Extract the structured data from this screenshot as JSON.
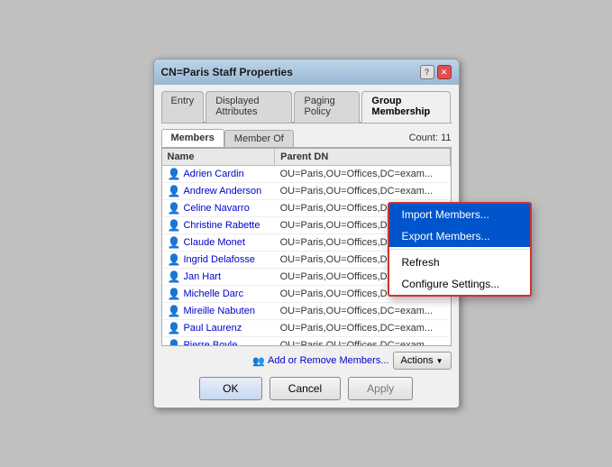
{
  "window": {
    "title": "CN=Paris Staff Properties",
    "help_label": "?",
    "close_label": "✕"
  },
  "tabs": [
    {
      "id": "entry",
      "label": "Entry"
    },
    {
      "id": "displayed-attributes",
      "label": "Displayed Attributes"
    },
    {
      "id": "paging-policy",
      "label": "Paging Policy"
    },
    {
      "id": "group-membership",
      "label": "Group Membership",
      "active": true
    }
  ],
  "inner_tabs": [
    {
      "id": "members",
      "label": "Members",
      "active": true
    },
    {
      "id": "member-of",
      "label": "Member Of"
    }
  ],
  "count_label": "Count: 11",
  "columns": [
    {
      "id": "name",
      "label": "Name"
    },
    {
      "id": "parent-dn",
      "label": "Parent DN"
    }
  ],
  "members": [
    {
      "name": "Adrien Cardin",
      "dn": "OU=Paris,OU=Offices,DC=exam..."
    },
    {
      "name": "Andrew Anderson",
      "dn": "OU=Paris,OU=Offices,DC=exam..."
    },
    {
      "name": "Celine Navarro",
      "dn": "OU=Paris,OU=Offices,DC=exam..."
    },
    {
      "name": "Christine Rabette",
      "dn": "OU=Paris,OU=Offices,DC=exam..."
    },
    {
      "name": "Claude Monet",
      "dn": "OU=Paris,OU=Offices,DC=exam..."
    },
    {
      "name": "Ingrid Delafosse",
      "dn": "OU=Paris,OU=Offices,DC=exam..."
    },
    {
      "name": "Jan Hart",
      "dn": "OU=Paris,OU=Offices,DC=exam..."
    },
    {
      "name": "Michelle Darc",
      "dn": "OU=Paris,OU=Offices,DC=exam..."
    },
    {
      "name": "Mireille Nabuten",
      "dn": "OU=Paris,OU=Offices,DC=exam..."
    },
    {
      "name": "Paul Laurenz",
      "dn": "OU=Paris,OU=Offices,DC=exam..."
    },
    {
      "name": "Pierre Boyle",
      "dn": "OU=Paris,OU=Offices,DC=exam..."
    }
  ],
  "add_remove_label": "Add or Remove Members...",
  "actions_label": "Actions",
  "actions_chevron": "▼",
  "dropdown": {
    "items": [
      {
        "id": "import-members",
        "label": "Import Members...",
        "highlighted": true
      },
      {
        "id": "export-members",
        "label": "Export Members...",
        "highlighted": true
      },
      {
        "id": "refresh",
        "label": "Refresh"
      },
      {
        "id": "configure-settings",
        "label": "Configure Settings..."
      }
    ]
  },
  "buttons": {
    "ok": "OK",
    "cancel": "Cancel",
    "apply": "Apply"
  }
}
